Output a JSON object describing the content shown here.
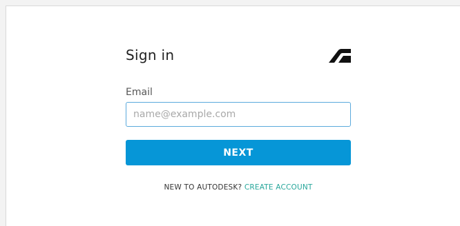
{
  "signin": {
    "title": "Sign in",
    "logo_icon": "autodesk-logo-icon",
    "email_label": "Email",
    "email_placeholder": "name@example.com",
    "email_value": "",
    "next_label": "NEXT",
    "new_user_text": "NEW TO AUTODESK?",
    "create_account_label": "CREATE ACCOUNT"
  },
  "colors": {
    "accent": "#0696d7",
    "link": "#26a69a",
    "input_border": "#5aa9dc"
  }
}
